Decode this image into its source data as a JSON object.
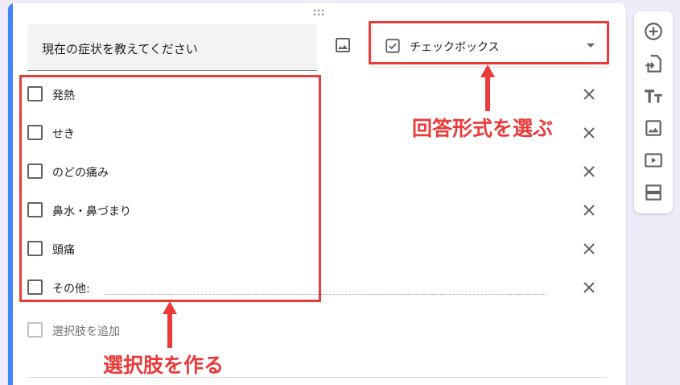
{
  "question": {
    "title": "現在の症状を教えてください"
  },
  "type_selector": {
    "label": "チェックボックス"
  },
  "options": [
    {
      "label": "発熱"
    },
    {
      "label": "せき"
    },
    {
      "label": "のどの痛み"
    },
    {
      "label": "鼻水・鼻づまり"
    },
    {
      "label": "頭痛"
    },
    {
      "label": "その他:"
    }
  ],
  "add_option": {
    "label": "選択肢を追加"
  },
  "annotations": {
    "answer_type": "回答形式を選ぶ",
    "create_options": "選択肢を作る"
  },
  "toolbar": {
    "icons": [
      "add-question-icon",
      "import-questions-icon",
      "add-title-icon",
      "add-image-icon",
      "add-video-icon",
      "add-section-icon"
    ]
  },
  "colors": {
    "accent": "#4285f4",
    "annotation": "#ea3a3a"
  }
}
